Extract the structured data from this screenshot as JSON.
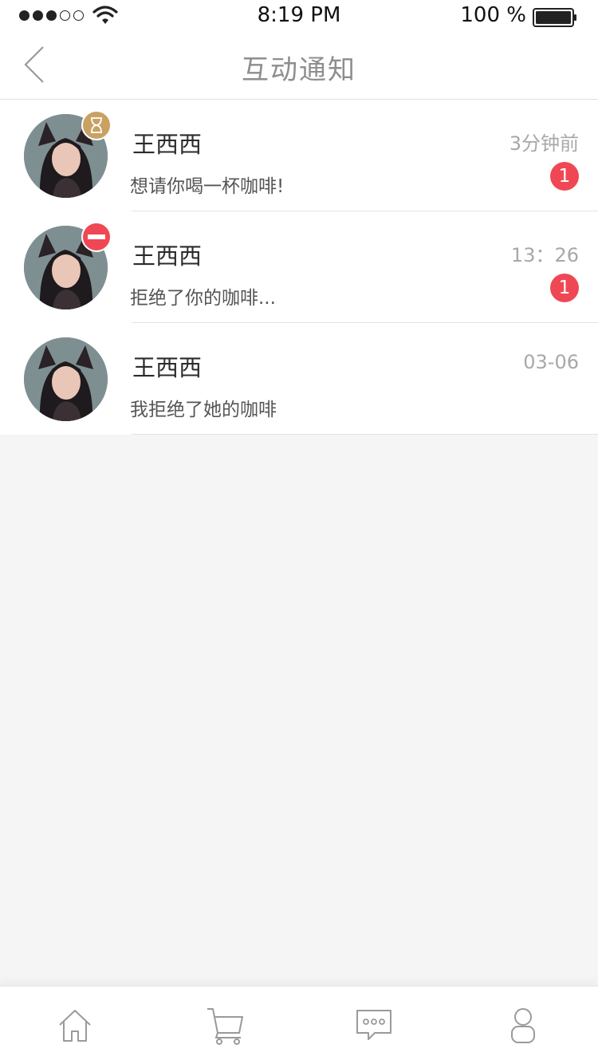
{
  "status_bar": {
    "time": "8:19 PM",
    "battery": "100 %",
    "signal_icon": "signal-dots-icon",
    "wifi_icon": "wifi-icon",
    "battery_icon": "battery-icon"
  },
  "nav": {
    "title": "互动通知",
    "back_icon": "chevron-left-icon"
  },
  "notifications": [
    {
      "name": "王西西",
      "message": "想请你喝一杯咖啡!",
      "time": "3分钟前",
      "unread": "1",
      "status_icon": "hourglass-icon",
      "status_color": "#c9a163"
    },
    {
      "name": "王西西",
      "message": "拒绝了你的咖啡...",
      "time": "13：26",
      "unread": "1",
      "status_icon": "no-entry-icon",
      "status_color": "#ef4854"
    },
    {
      "name": "王西西",
      "message": "我拒绝了她的咖啡",
      "time": "03-06",
      "unread": "",
      "status_icon": "",
      "status_color": ""
    }
  ],
  "tab_bar": {
    "tabs": [
      {
        "icon": "home-icon"
      },
      {
        "icon": "cart-icon"
      },
      {
        "icon": "chat-bubble-icon"
      },
      {
        "icon": "profile-icon"
      }
    ]
  },
  "colors": {
    "accent_red": "#ef4854",
    "pending_gold": "#c9a163",
    "background": "#f5f5f5"
  }
}
